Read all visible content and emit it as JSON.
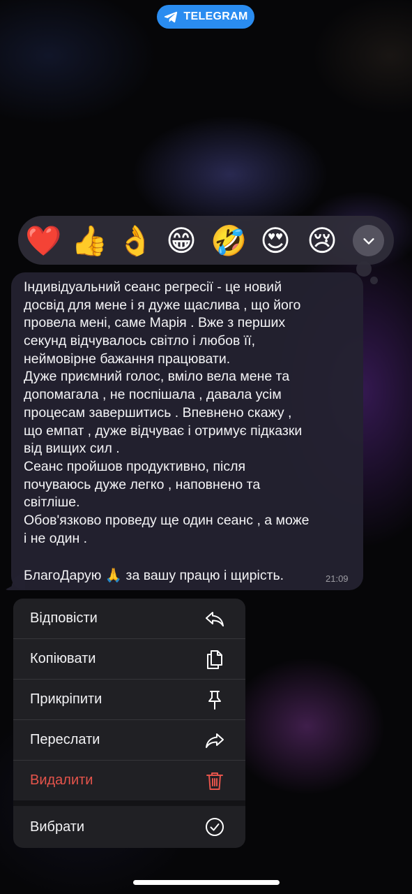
{
  "badge": {
    "label": "TELEGRAM",
    "icon": "telegram-plane-icon",
    "color": "#2a8cf0"
  },
  "reactions": [
    {
      "emoji": "❤️",
      "name": "heart"
    },
    {
      "emoji": "👍",
      "name": "thumbs-up"
    },
    {
      "emoji": "👌",
      "name": "ok-hand"
    },
    {
      "emoji": "😁",
      "name": "grinning"
    },
    {
      "emoji": "🤣",
      "name": "rolling-laughing"
    },
    {
      "emoji": "😍",
      "name": "heart-eyes"
    },
    {
      "emoji": "😢",
      "name": "crying"
    }
  ],
  "reactions_expand_icon": "chevron-down-icon",
  "message": {
    "lines": [
      "Індивідуальний сеанс регресії - це новий",
      "досвід для мене і я дуже щаслива , що його",
      "провела мені, саме Марія . Вже з перших",
      "секунд відчувалось світло і любов її,",
      "неймовірне бажання працювати.",
      "Дуже приємний голос, вміло вела мене та",
      "допомагала , не поспішала , давала усім",
      "процесам завершитись . Впевнено скажу ,",
      "що емпат , дуже відчуває і отримує підказки",
      "від вищих сил .",
      "Сеанс пройшов продуктивно, після",
      "почуваюсь дуже легко , наповнено та",
      "світліше.",
      "Обов'язково проведу ще один сеанс , а може",
      "і не один ."
    ],
    "last_line": "БлагоДарую 🙏 за вашу працю і щирість.",
    "time": "21:09"
  },
  "menu": {
    "items": [
      {
        "label": "Відповісти",
        "icon": "reply-icon",
        "danger": false
      },
      {
        "label": "Копіювати",
        "icon": "copy-icon",
        "danger": false
      },
      {
        "label": "Прикріпити",
        "icon": "pin-icon",
        "danger": false
      },
      {
        "label": "Переслати",
        "icon": "forward-icon",
        "danger": false
      },
      {
        "label": "Видалити",
        "icon": "trash-icon",
        "danger": true
      }
    ],
    "select": {
      "label": "Вибрати",
      "icon": "checkmark-circle-icon"
    }
  },
  "colors": {
    "danger": "#e5544b",
    "menu_bg": "#202024",
    "bubble_bg": "#242230"
  }
}
